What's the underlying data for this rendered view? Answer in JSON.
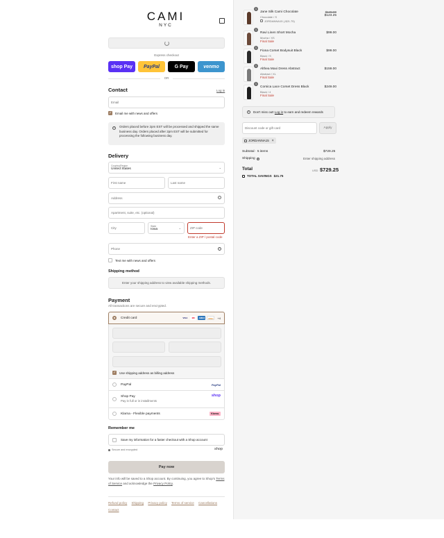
{
  "brand": {
    "name": "CAMI",
    "sub": "NYC"
  },
  "express": {
    "label": "Express checkout",
    "or": "OR",
    "buttons": [
      {
        "label": "shop Pay",
        "color": "#5a31f4"
      },
      {
        "label": "PayPal",
        "color": "#ffc439"
      },
      {
        "label": "G Pay",
        "color": "#000000"
      },
      {
        "label": "venmo",
        "color": "#3d95ce"
      }
    ]
  },
  "contact": {
    "title": "Contact",
    "login": "Log in",
    "email_placeholder": "Email",
    "email_opt": "Email me with news and offers",
    "notice": "Orders placed before 2pm EST will be processed and shipped the same business day. Orders placed after 2pm EST will be submitted for processing the following business day."
  },
  "delivery": {
    "title": "Delivery",
    "country_label": "Country/Region",
    "country_value": "United States",
    "first_name": "First name",
    "last_name": "Last name",
    "address": "Address",
    "apartment": "Apartment, suite, etc. (optional)",
    "city": "City",
    "state_label": "State",
    "state_value": "Iowa",
    "zip": "ZIP code",
    "zip_error": "Enter a ZIP / postal code",
    "phone": "Phone",
    "text_opt": "Text me with news and offers"
  },
  "shipping": {
    "title": "Shipping method",
    "notice": "Enter your shipping address to view available shipping methods."
  },
  "payment": {
    "title": "Payment",
    "subtitle": "All transactions are secure and encrypted.",
    "credit_card": "Credit card",
    "card_logos": [
      "VISA",
      "MC",
      "AMEX",
      "DISC"
    ],
    "more_cards": "+4",
    "billing_same": "Use shipping address as billing address",
    "paypal": "PayPal",
    "paypal_logo": "PayPal",
    "shoppay": "Shop Pay",
    "shoppay_sub": "Pay in full or in installments",
    "shoppay_logo": "shop",
    "klarna": "Klarna - Flexible payments",
    "klarna_logo": "Klarna."
  },
  "remember": {
    "title": "Remember me",
    "save": "Save my information for a faster checkout with a Shop account",
    "secure": "Secure and encrypted",
    "shop_logo": "shop"
  },
  "pay_now": "Pay now",
  "legal": {
    "text": "Your info will be saved to a Shop account. By continuing, you agree to Shop's",
    "terms": "Terms of Service",
    "mid": " and acknowledge the ",
    "privacy": "Privacy Policy",
    "end": "."
  },
  "footer": [
    "Refund policy",
    "Shipping",
    "Privacy policy",
    "Terms of service",
    "Cancellations",
    "Contact"
  ],
  "cart": {
    "items": [
      {
        "name": "Jane Silk Cami Chocolate",
        "variant": "Chocolate / S",
        "discount": "JORDANNA15 (-$21.75)",
        "orig": "$145.00",
        "price": "$123.25",
        "qty": "1",
        "color": "#5b3a2a"
      },
      {
        "name": "Ravi Linen Short Mocha",
        "variant": "Mocha / XS",
        "final": "Final Sale",
        "price": "$99.00",
        "qty": "1",
        "color": "#6b4a3a"
      },
      {
        "name": "Fiona Corset Bodysuit Black",
        "variant": "Black / S",
        "final": "Final Sale",
        "price": "$99.00",
        "qty": "1",
        "color": "#2a2a2a"
      },
      {
        "name": "Althea Maxi Dress Abstract",
        "variant": "Abstract / XL",
        "final": "Final Sale",
        "price": "$159.00",
        "qty": "1",
        "color": "#7a7a7a"
      },
      {
        "name": "Corsica Lace Corset Dress Black",
        "variant": "Black / 4",
        "final": "Final Sale",
        "price": "$249.00",
        "qty": "1",
        "color": "#1e1e1e"
      }
    ],
    "rewards_pre": "Don't miss out! ",
    "rewards_link": "Log in",
    "rewards_post": " to earn and redeem rewards",
    "discount_placeholder": "Discount code or gift card",
    "apply": "Apply",
    "code_tag": "JORDANNA15",
    "subtotal_label": "Subtotal · 5 items",
    "subtotal": "$729.25",
    "shipping_label": "Shipping",
    "shipping_value": "Enter shipping address",
    "total_label": "Total",
    "currency": "USD",
    "total": "$729.25",
    "savings_label": "TOTAL SAVINGS",
    "savings": "$21.75"
  }
}
